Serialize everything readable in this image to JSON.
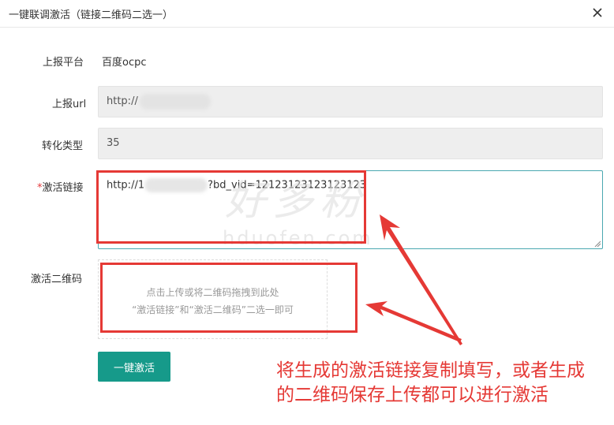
{
  "dialog": {
    "title": "一键联调激活（链接二维码二选一）"
  },
  "form": {
    "platform": {
      "label": "上报平台",
      "value": "百度ocpc"
    },
    "url": {
      "label": "上报url",
      "value_prefix": "http://"
    },
    "conversion_type": {
      "label": "转化类型",
      "value": "35"
    },
    "activation_link": {
      "required_mark": "*",
      "label": "激活链接",
      "value_prefix": "http://1",
      "value_suffix": "?bd_vid=12123123123123123"
    },
    "qr_code": {
      "label": "激活二维码",
      "upload_hint_line1": "点击上传或将二维码拖拽到此处",
      "upload_hint_line2": "“激活链接”和“激活二维码”二选一即可"
    },
    "submit_label": "一键激活"
  },
  "watermark": {
    "text_cn": "好多粉",
    "text_en": "hduofen.com"
  },
  "annotation": {
    "note_line1": "将生成的激活链接复制填写，或者生成",
    "note_line2": "的二维码保存上传都可以进行激活",
    "color": "#e53935"
  },
  "icons": {
    "close": "close-icon"
  },
  "colors": {
    "primary": "#169a8a",
    "focus_border": "#4aa8b0",
    "readonly_bg": "#eeeeee",
    "required": "#e4393c"
  }
}
